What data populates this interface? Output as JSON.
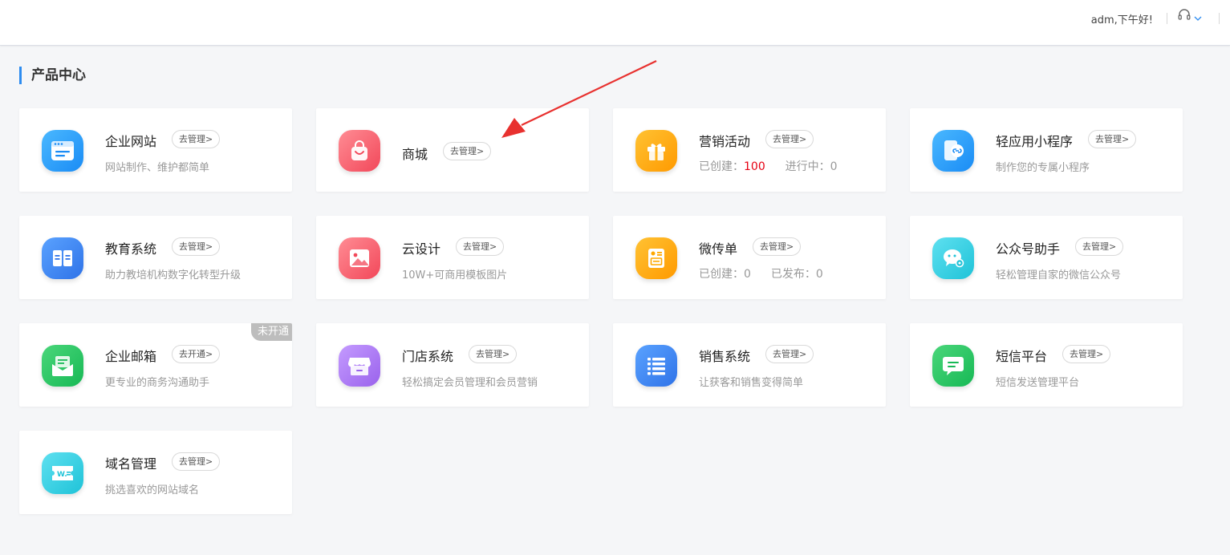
{
  "header": {
    "greeting": "adm,下午好!"
  },
  "page": {
    "title": "产品中心"
  },
  "products": [
    {
      "title": "企业网站",
      "action": "去管理>",
      "desc": "网站制作、维护都简单"
    },
    {
      "title": "商城",
      "action": "去管理>"
    },
    {
      "title": "营销活动",
      "action": "去管理>",
      "stats": [
        {
          "label": "已创建：",
          "value": "100"
        },
        {
          "label": "进行中：",
          "value": "0"
        }
      ]
    },
    {
      "title": "轻应用小程序",
      "action": "去管理>",
      "desc": "制作您的专属小程序"
    },
    {
      "title": "教育系统",
      "action": "去管理>",
      "desc": "助力教培机构数字化转型升级"
    },
    {
      "title": "云设计",
      "action": "去管理>",
      "desc": "10W+可商用模板图片"
    },
    {
      "title": "微传单",
      "action": "去管理>",
      "stats": [
        {
          "label": "已创建：",
          "value": "0"
        },
        {
          "label": "已发布：",
          "value": "0"
        }
      ]
    },
    {
      "title": "公众号助手",
      "action": "去管理>",
      "desc": "轻松管理自家的微信公众号"
    },
    {
      "title": "企业邮箱",
      "action": "去开通>",
      "desc": "更专业的商务沟通助手",
      "badge": "未开通"
    },
    {
      "title": "门店系统",
      "action": "去管理>",
      "desc": "轻松搞定会员管理和会员营销"
    },
    {
      "title": "销售系统",
      "action": "去管理>",
      "desc": "让获客和销售变得简单"
    },
    {
      "title": "短信平台",
      "action": "去管理>",
      "desc": "短信发送管理平台"
    },
    {
      "title": "域名管理",
      "action": "去管理>",
      "desc": "挑选喜欢的网站域名"
    }
  ],
  "colors": {
    "accent": "#2d8cf0",
    "highlight_number": "#e60012",
    "annotation_arrow": "#e8312f"
  },
  "icons": [
    "website-icon",
    "shop-bag-icon",
    "gift-icon",
    "mini-program-icon",
    "book-icon",
    "image-icon",
    "flyer-icon",
    "wechat-icon",
    "mail-icon",
    "store-icon",
    "list-icon",
    "sms-icon",
    "domain-icon",
    "headset-icon",
    "chevron-down-icon"
  ]
}
